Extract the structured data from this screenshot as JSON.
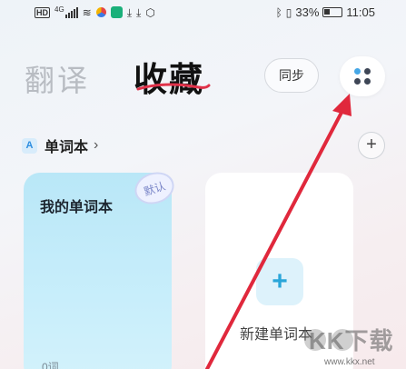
{
  "status_bar": {
    "hd": "HD",
    "signal": "4G",
    "battery_percent": "33%",
    "time": "11:05"
  },
  "header": {
    "tab_translate": "翻译",
    "tab_favorites": "收藏",
    "sync_label": "同步",
    "accent_underline_color": "#e0324a"
  },
  "section": {
    "icon_letter": "A",
    "title": "单词本",
    "chevron": "›",
    "add_symbol": "+"
  },
  "cards": {
    "mine": {
      "title": "我的单词本",
      "count": "0词",
      "badge": "默认"
    },
    "new": {
      "plus": "+",
      "label": "新建单词本"
    }
  },
  "watermark": {
    "text": "KK下载",
    "url": "www.kkx.net"
  },
  "annotation": {
    "arrow_color": "#e0283c"
  }
}
